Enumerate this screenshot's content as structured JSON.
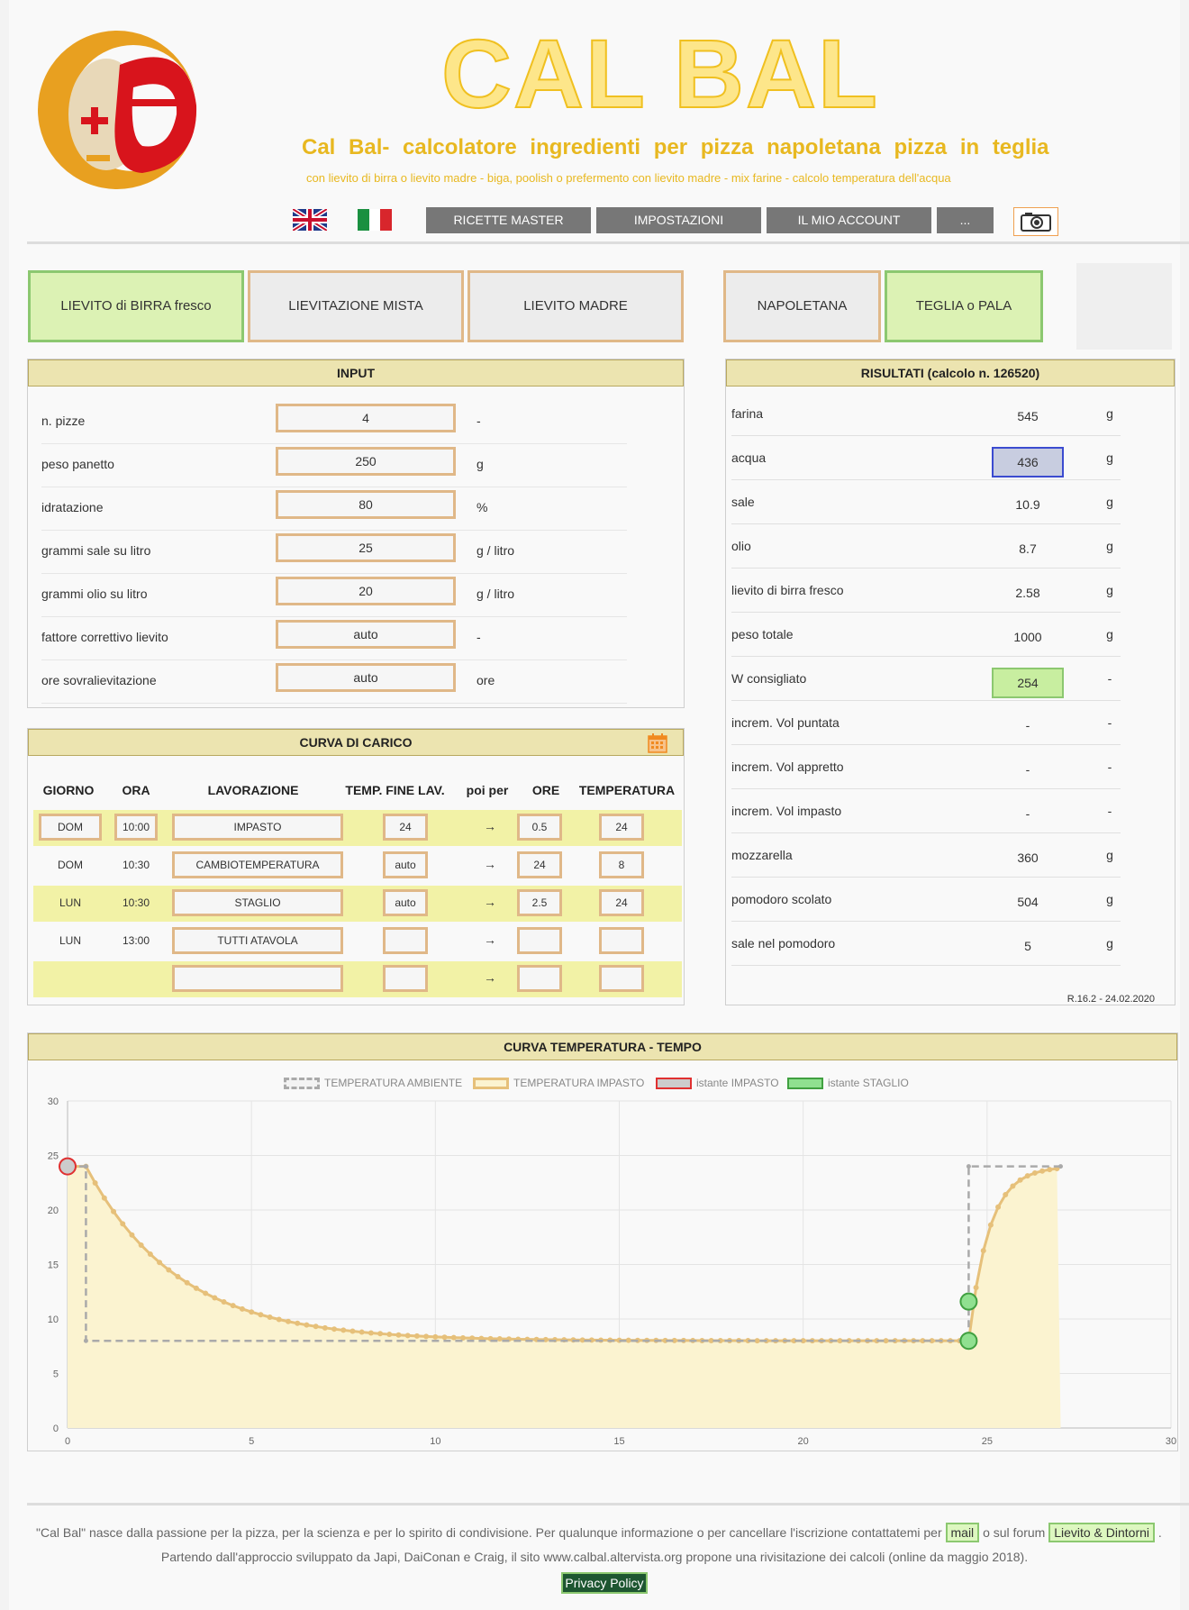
{
  "header": {
    "app_title": "CAL BAL",
    "subtitle": "Cal Bal-   calcolatore ingredienti per pizza   napoletana pizza in   teglia",
    "tagline": "con lievito di birra o lievito madre - biga, poolish o prefermento con lievito madre - mix farine - calcolo temperatura dell'acqua",
    "nav": [
      "RICETTE MASTER",
      "IMPOSTAZIONI",
      "IL MIO ACCOUNT",
      "..."
    ]
  },
  "modes": {
    "yeast": [
      "LIEVITO di BIRRA fresco",
      "LIEVITAZIONE MISTA",
      "LIEVITO MADRE"
    ],
    "style": [
      "NAPOLETANA",
      "TEGLIA o PALA"
    ]
  },
  "input": {
    "title": "INPUT",
    "rows": [
      {
        "label": "n. pizze",
        "value": "4",
        "unit": "-"
      },
      {
        "label": "peso panetto",
        "value": "250",
        "unit": "g"
      },
      {
        "label": "idratazione",
        "value": "80",
        "unit": "%"
      },
      {
        "label": "grammi sale su litro",
        "value": "25",
        "unit": "g / litro"
      },
      {
        "label": "grammi olio su litro",
        "value": "20",
        "unit": "g / litro"
      },
      {
        "label": "fattore correttivo lievito",
        "value": "auto",
        "unit": "-"
      },
      {
        "label": "ore sovralievitazione",
        "value": "auto",
        "unit": "ore"
      }
    ]
  },
  "results": {
    "title": "RISULTATI (calcolo n. 126520)",
    "rows": [
      {
        "label": "farina",
        "value": "545",
        "unit": "g"
      },
      {
        "label": "acqua",
        "value": "436",
        "unit": "g"
      },
      {
        "label": "sale",
        "value": "10.9",
        "unit": "g"
      },
      {
        "label": "olio",
        "value": "8.7",
        "unit": "g"
      },
      {
        "label": "lievito di birra fresco",
        "value": "2.58",
        "unit": "g"
      },
      {
        "label": "peso totale",
        "value": "1000",
        "unit": "g"
      },
      {
        "label": "W consigliato",
        "value": "254",
        "unit": "-"
      },
      {
        "label": "increm. Vol puntata",
        "value": "-",
        "unit": "-"
      },
      {
        "label": "increm. Vol appretto",
        "value": "-",
        "unit": "-"
      },
      {
        "label": "increm. Vol impasto",
        "value": "-",
        "unit": "-"
      },
      {
        "label": "mozzarella",
        "value": "360",
        "unit": "g"
      },
      {
        "label": "pomodoro scolato",
        "value": "504",
        "unit": "g"
      },
      {
        "label": "sale nel pomodoro",
        "value": "5",
        "unit": "g"
      }
    ],
    "version": "R.16.2 - 24.02.2020"
  },
  "schedule": {
    "title": "CURVA DI CARICO",
    "headers": [
      "GIORNO",
      "ORA",
      "LAVORAZIONE",
      "TEMP. FINE LAV.",
      "poi per",
      "ORE",
      "TEMPERATURA"
    ],
    "rows": [
      {
        "giorno": "DOM",
        "ora": "10:00",
        "lav": "IMPASTO",
        "temp": "24",
        "arrow": "→",
        "ore": "0.5",
        "t": "24"
      },
      {
        "giorno": "DOM",
        "ora": "10:30",
        "lav": "CAMBIOTEMPERATURA",
        "temp": "auto",
        "arrow": "→",
        "ore": "24",
        "t": "8"
      },
      {
        "giorno": "LUN",
        "ora": "10:30",
        "lav": "STAGLIO",
        "temp": "auto",
        "arrow": "→",
        "ore": "2.5",
        "t": "24"
      },
      {
        "giorno": "LUN",
        "ora": "13:00",
        "lav": "TUTTI  ATAVOLA",
        "temp": "",
        "arrow": "→",
        "ore": "",
        "t": ""
      },
      {
        "giorno": "",
        "ora": "",
        "lav": "",
        "temp": "",
        "arrow": "→",
        "ore": "",
        "t": ""
      }
    ]
  },
  "chart_title": "CURVA TEMPERATURA - TEMPO",
  "chart_data": {
    "type": "line",
    "legend": [
      "TEMPERATURA AMBIENTE",
      "TEMPERATURA IMPASTO",
      "istante IMPASTO",
      "istante STAGLIO"
    ],
    "legend_position": "top",
    "x_ticks": [
      "0",
      "5",
      "10",
      "15",
      "20",
      "25",
      "30"
    ],
    "y_ticks": [
      "0",
      "5",
      "10",
      "15",
      "20",
      "25",
      "30"
    ],
    "xlim": [
      0,
      30
    ],
    "ylim": [
      0,
      30
    ],
    "grid": true,
    "colors": {
      "ambient": "#aaaaaa",
      "dough": "#e6c07a",
      "dough_fill": "#fbf3d0",
      "impasto": "#e03030",
      "staglio": "#40a040"
    },
    "series": [
      {
        "name": "TEMPERATURA AMBIENTE",
        "points": [
          [
            0,
            24
          ],
          [
            0.5,
            24
          ],
          [
            0.5,
            8
          ],
          [
            24.5,
            8
          ],
          [
            24.5,
            24
          ],
          [
            27,
            24
          ]
        ]
      },
      {
        "name": "TEMPERATURA IMPASTO",
        "decay_from": 24,
        "decay_to": 8,
        "x_start": 0.5,
        "x_end": 24.5,
        "rise_to": 24,
        "x_final": 27
      },
      {
        "name": "istante IMPASTO",
        "points": [
          [
            0,
            24
          ]
        ]
      },
      {
        "name": "istante STAGLIO",
        "points": [
          [
            24.5,
            8
          ],
          [
            24.5,
            11.6
          ]
        ]
      }
    ]
  },
  "footer": {
    "line1_pre": "\"Cal Bal\" nasce dalla passione per la pizza, per la scienza e per lo spirito di condivisione. Per qualunque informazione o per cancellare l'iscrizione contattatemi per",
    "mail": "mail",
    "line1_mid": "o sul forum",
    "forum": "Lievito & Dintorni",
    "line1_end": ".",
    "line2": "Partendo dall'approccio sviluppato da Japi, DaiConan e Craig, il sito www.calbal.altervista.org propone una rivisitazione dei calcoli (online da maggio 2018).",
    "privacy": "Privacy Policy"
  }
}
